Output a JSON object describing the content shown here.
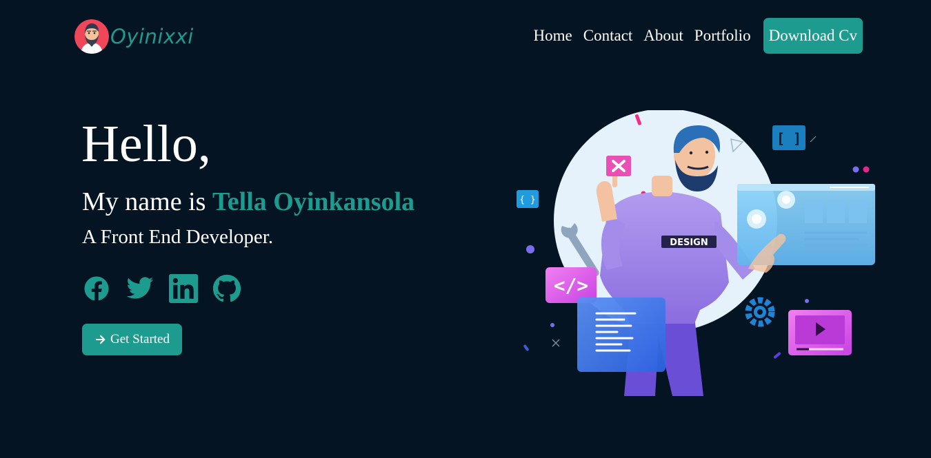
{
  "brand": {
    "name": "Oyinixxi",
    "accent_color": "#1d9b8f",
    "background_color": "#051422"
  },
  "nav": {
    "links": [
      "Home",
      "Contact",
      "About",
      "Portfolio"
    ],
    "download_label": "Download Cv"
  },
  "hero": {
    "greeting": "Hello,",
    "name_prefix": "My name is ",
    "name": "Tella Oyinkansola",
    "role": "A Front End Developer.",
    "cta_label": "Get Started",
    "cta_icon": "arrow-right-icon"
  },
  "socials": [
    {
      "name": "facebook",
      "icon": "facebook-icon"
    },
    {
      "name": "twitter",
      "icon": "twitter-icon"
    },
    {
      "name": "linkedin",
      "icon": "linkedin-icon"
    },
    {
      "name": "github",
      "icon": "github-icon"
    }
  ],
  "illustration": {
    "shirt_text": "DESIGN",
    "code_badge": "</>"
  }
}
